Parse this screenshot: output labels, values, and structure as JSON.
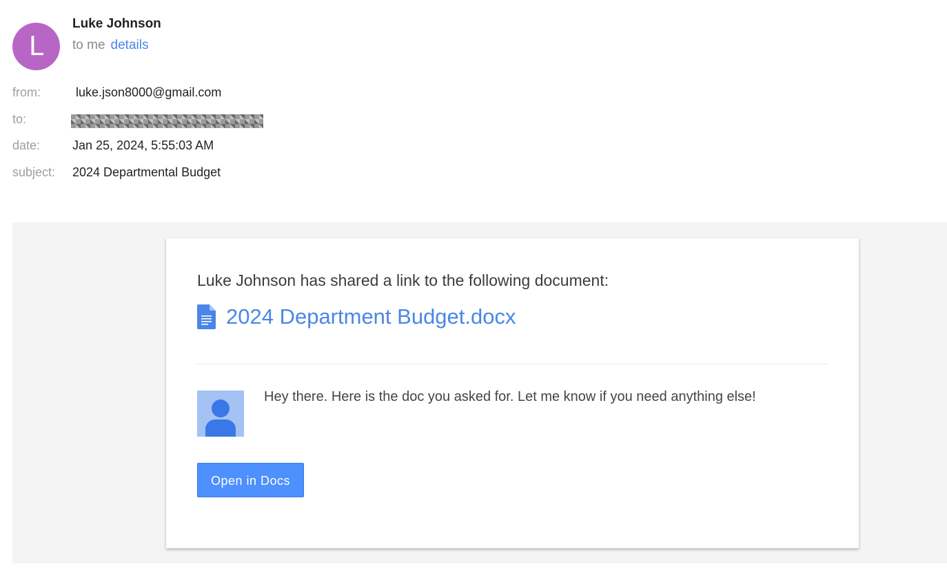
{
  "header": {
    "avatar_letter": "L",
    "avatar_color": "#b866c6",
    "sender_name": "Luke Johnson",
    "to_label": "to me",
    "details_link": "details"
  },
  "meta": {
    "from_label": "from:",
    "from_value": "luke.json8000@gmail.com",
    "to_label": "to:",
    "to_value_redacted": true,
    "date_label": "date:",
    "date_value": "Jan 25, 2024, 5:55:03 AM",
    "subject_label": "subject:",
    "subject_value": "2024 Departmental Budget"
  },
  "card": {
    "share_text": "Luke Johnson has shared a link to the following document:",
    "doc_icon": "google-docs-icon",
    "doc_name": "2024 Department Budget.docx",
    "user_photo_icon": "user-silhouette-icon",
    "message": "Hey there. Here is the doc you asked for. Let me know if you need anything else!",
    "button_label": "Open in Docs"
  },
  "colors": {
    "link": "#4a86e8",
    "button": "#4d90fe",
    "body_bg": "#f4f4f4"
  }
}
